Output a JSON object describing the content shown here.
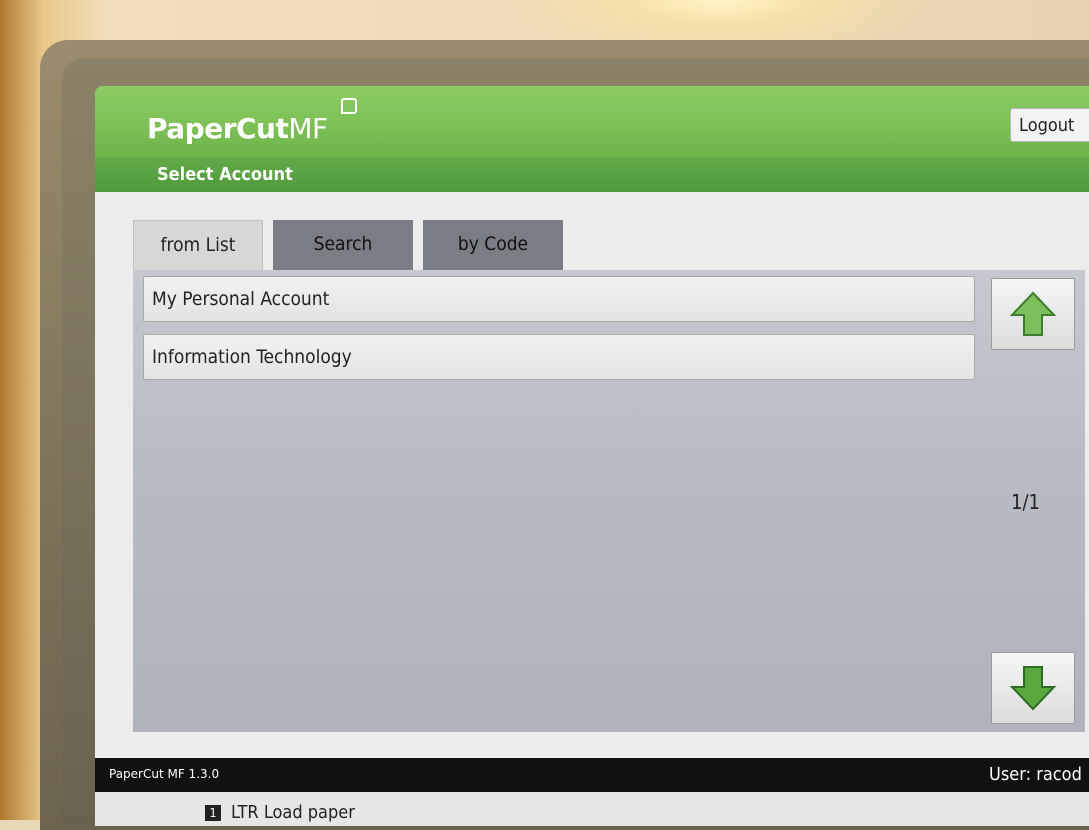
{
  "header": {
    "logo_text_a": "PaperCut",
    "logo_text_b": "MF",
    "logout_label": "Logout",
    "subtitle": "Select Account"
  },
  "tabs": [
    {
      "label": "from List",
      "active": true
    },
    {
      "label": "Search",
      "active": false
    },
    {
      "label": "by Code",
      "active": false
    }
  ],
  "accounts": [
    {
      "label": "My Personal Account"
    },
    {
      "label": "Information Technology"
    }
  ],
  "pagination": {
    "text": "1/1"
  },
  "status": {
    "version": "PaperCut MF 1.3.0",
    "user": "User: racod"
  },
  "footer": {
    "tray_number": "1",
    "message": "LTR  Load paper"
  },
  "colors": {
    "header_green": "#7bbf55",
    "subheader_green": "#58a342",
    "arrow_green": "#6db24c"
  },
  "icons": {
    "up": "arrow-up-icon",
    "down": "arrow-down-icon"
  }
}
